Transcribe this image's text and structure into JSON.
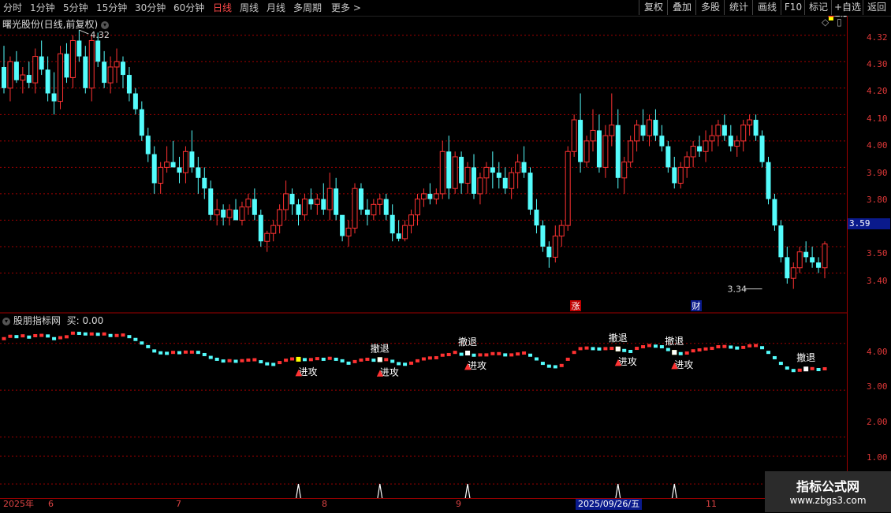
{
  "toolbar": {
    "timeframes": [
      "分时",
      "1分钟",
      "5分钟",
      "15分钟",
      "30分钟",
      "60分钟",
      "日线",
      "周线",
      "月线",
      "多周期",
      "更多 >"
    ],
    "active": "日线",
    "buttons": [
      "复权",
      "叠加",
      "多股",
      "统计",
      "画线",
      "F10",
      "标记",
      "+自选",
      "返回"
    ]
  },
  "main_title": "曙光股份(日线,前复权)",
  "indicator_title": "股朋指标网",
  "indicator_value": "买: 0.00",
  "price_axis": [
    "4.30",
    "4.20",
    "4.10",
    "4.00",
    "3.90",
    "3.80",
    "3.70",
    "3.60",
    "3.50",
    "3.40"
  ],
  "top_tick": "4.32",
  "current_price": "3.59",
  "high_mark": "4.32",
  "low_mark": "3.34",
  "event_markers": [
    "涨",
    "财"
  ],
  "indicator_axis": [
    "4.00",
    "3.00",
    "2.00",
    "1.00"
  ],
  "signals": {
    "retreat": "撤退",
    "attack": "进攻"
  },
  "date_labels": [
    "2025年",
    "6",
    "7",
    "8",
    "9",
    "2025/09/26/五",
    "11"
  ],
  "watermark": {
    "line1": "指标公式网",
    "line2": "www.zbgs3.com"
  },
  "colors": {
    "up": "#ff3232",
    "down": "#54fcfc",
    "signal": "#ffff00",
    "axis": "#a00000"
  },
  "chart_data": {
    "type": "candlestick",
    "candles_ohlc": [
      [
        4.18,
        4.26,
        4.08,
        4.1
      ],
      [
        4.1,
        4.22,
        4.05,
        4.2
      ],
      [
        4.2,
        4.24,
        4.12,
        4.13
      ],
      [
        4.13,
        4.18,
        4.08,
        4.15
      ],
      [
        4.15,
        4.2,
        4.1,
        4.12
      ],
      [
        4.12,
        4.25,
        4.08,
        4.22
      ],
      [
        4.22,
        4.28,
        4.15,
        4.17
      ],
      [
        4.17,
        4.22,
        4.05,
        4.08
      ],
      [
        4.08,
        4.16,
        4.0,
        4.05
      ],
      [
        4.05,
        4.26,
        4.02,
        4.23
      ],
      [
        4.23,
        4.27,
        4.12,
        4.14
      ],
      [
        4.14,
        4.3,
        4.1,
        4.28
      ],
      [
        4.28,
        4.32,
        4.2,
        4.22
      ],
      [
        4.22,
        4.26,
        4.08,
        4.1
      ],
      [
        4.1,
        4.3,
        4.05,
        4.28
      ],
      [
        4.28,
        4.31,
        4.18,
        4.2
      ],
      [
        4.2,
        4.24,
        4.1,
        4.12
      ],
      [
        4.12,
        4.22,
        4.08,
        4.18
      ],
      [
        4.18,
        4.25,
        4.12,
        4.2
      ],
      [
        4.2,
        4.22,
        4.1,
        4.15
      ],
      [
        4.15,
        4.18,
        4.05,
        4.08
      ],
      [
        4.08,
        4.1,
        4.0,
        4.02
      ],
      [
        4.02,
        4.05,
        3.9,
        3.92
      ],
      [
        3.92,
        3.95,
        3.82,
        3.85
      ],
      [
        3.85,
        3.88,
        3.7,
        3.74
      ],
      [
        3.74,
        3.82,
        3.7,
        3.8
      ],
      [
        3.8,
        3.88,
        3.78,
        3.82
      ],
      [
        3.82,
        3.9,
        3.8,
        3.8
      ],
      [
        3.8,
        3.84,
        3.74,
        3.78
      ],
      [
        3.78,
        3.88,
        3.74,
        3.86
      ],
      [
        3.86,
        3.94,
        3.78,
        3.8
      ],
      [
        3.8,
        3.84,
        3.7,
        3.76
      ],
      [
        3.76,
        3.8,
        3.68,
        3.72
      ],
      [
        3.72,
        3.75,
        3.6,
        3.62
      ],
      [
        3.62,
        3.68,
        3.58,
        3.64
      ],
      [
        3.64,
        3.66,
        3.58,
        3.61
      ],
      [
        3.61,
        3.66,
        3.58,
        3.64
      ],
      [
        3.64,
        3.68,
        3.6,
        3.6
      ],
      [
        3.6,
        3.67,
        3.58,
        3.65
      ],
      [
        3.65,
        3.7,
        3.62,
        3.68
      ],
      [
        3.68,
        3.72,
        3.6,
        3.62
      ],
      [
        3.62,
        3.64,
        3.5,
        3.52
      ],
      [
        3.52,
        3.56,
        3.48,
        3.55
      ],
      [
        3.55,
        3.6,
        3.52,
        3.58
      ],
      [
        3.58,
        3.66,
        3.55,
        3.64
      ],
      [
        3.64,
        3.75,
        3.6,
        3.7
      ],
      [
        3.7,
        3.72,
        3.62,
        3.66
      ],
      [
        3.66,
        3.68,
        3.58,
        3.62
      ],
      [
        3.62,
        3.7,
        3.6,
        3.68
      ],
      [
        3.68,
        3.72,
        3.64,
        3.66
      ],
      [
        3.66,
        3.7,
        3.62,
        3.68
      ],
      [
        3.68,
        3.74,
        3.62,
        3.64
      ],
      [
        3.64,
        3.78,
        3.6,
        3.72
      ],
      [
        3.72,
        3.76,
        3.6,
        3.62
      ],
      [
        3.62,
        3.58,
        3.52,
        3.54
      ],
      [
        3.54,
        3.6,
        3.5,
        3.57
      ],
      [
        3.57,
        3.74,
        3.55,
        3.72
      ],
      [
        3.72,
        3.74,
        3.62,
        3.64
      ],
      [
        3.64,
        3.68,
        3.58,
        3.62
      ],
      [
        3.62,
        3.68,
        3.6,
        3.66
      ],
      [
        3.66,
        3.7,
        3.62,
        3.68
      ],
      [
        3.68,
        3.7,
        3.6,
        3.62
      ],
      [
        3.62,
        3.66,
        3.52,
        3.55
      ],
      [
        3.55,
        3.6,
        3.52,
        3.53
      ],
      [
        3.53,
        3.6,
        3.52,
        3.58
      ],
      [
        3.58,
        3.64,
        3.55,
        3.62
      ],
      [
        3.62,
        3.7,
        3.58,
        3.68
      ],
      [
        3.68,
        3.72,
        3.65,
        3.7
      ],
      [
        3.7,
        3.74,
        3.66,
        3.68
      ],
      [
        3.68,
        3.72,
        3.66,
        3.7
      ],
      [
        3.7,
        3.9,
        3.68,
        3.86
      ],
      [
        3.86,
        3.92,
        3.68,
        3.72
      ],
      [
        3.72,
        3.86,
        3.7,
        3.84
      ],
      [
        3.84,
        3.86,
        3.7,
        3.74
      ],
      [
        3.74,
        3.82,
        3.7,
        3.8
      ],
      [
        3.8,
        3.85,
        3.68,
        3.7
      ],
      [
        3.7,
        3.78,
        3.66,
        3.76
      ],
      [
        3.76,
        3.82,
        3.7,
        3.8
      ],
      [
        3.8,
        3.86,
        3.72,
        3.78
      ],
      [
        3.78,
        3.82,
        3.72,
        3.76
      ],
      [
        3.76,
        3.8,
        3.7,
        3.72
      ],
      [
        3.72,
        3.8,
        3.68,
        3.78
      ],
      [
        3.78,
        3.85,
        3.72,
        3.82
      ],
      [
        3.82,
        3.88,
        3.76,
        3.78
      ],
      [
        3.78,
        3.8,
        3.62,
        3.64
      ],
      [
        3.64,
        3.68,
        3.55,
        3.58
      ],
      [
        3.58,
        3.6,
        3.48,
        3.5
      ],
      [
        3.5,
        3.52,
        3.42,
        3.46
      ],
      [
        3.46,
        3.58,
        3.44,
        3.54
      ],
      [
        3.54,
        3.6,
        3.5,
        3.58
      ],
      [
        3.58,
        3.88,
        3.56,
        3.86
      ],
      [
        3.86,
        4.0,
        3.84,
        3.98
      ],
      [
        3.98,
        4.08,
        3.78,
        3.82
      ],
      [
        3.82,
        3.92,
        3.8,
        3.9
      ],
      [
        3.9,
        4.02,
        3.86,
        3.94
      ],
      [
        3.94,
        4.0,
        3.78,
        3.8
      ],
      [
        3.8,
        3.96,
        3.76,
        3.92
      ],
      [
        3.92,
        4.08,
        3.88,
        3.96
      ],
      [
        3.96,
        4.02,
        3.72,
        3.76
      ],
      [
        3.76,
        3.84,
        3.7,
        3.82
      ],
      [
        3.82,
        3.92,
        3.8,
        3.9
      ],
      [
        3.9,
        3.98,
        3.86,
        3.96
      ],
      [
        3.96,
        4.02,
        3.9,
        3.92
      ],
      [
        3.92,
        4.0,
        3.88,
        3.98
      ],
      [
        3.98,
        4.02,
        3.9,
        3.92
      ],
      [
        3.92,
        3.96,
        3.86,
        3.88
      ],
      [
        3.88,
        3.9,
        3.78,
        3.8
      ],
      [
        3.8,
        3.84,
        3.72,
        3.74
      ],
      [
        3.74,
        3.82,
        3.72,
        3.8
      ],
      [
        3.8,
        3.86,
        3.76,
        3.84
      ],
      [
        3.84,
        3.9,
        3.8,
        3.88
      ],
      [
        3.88,
        3.92,
        3.84,
        3.86
      ],
      [
        3.86,
        3.94,
        3.82,
        3.9
      ],
      [
        3.9,
        3.96,
        3.86,
        3.92
      ],
      [
        3.92,
        3.98,
        3.88,
        3.96
      ],
      [
        3.96,
        4.0,
        3.9,
        3.92
      ],
      [
        3.92,
        3.96,
        3.86,
        3.88
      ],
      [
        3.88,
        3.92,
        3.84,
        3.9
      ],
      [
        3.9,
        3.98,
        3.86,
        3.96
      ],
      [
        3.96,
        4.0,
        3.92,
        3.98
      ],
      [
        3.98,
        4.0,
        3.9,
        3.92
      ],
      [
        3.92,
        3.94,
        3.8,
        3.82
      ],
      [
        3.82,
        3.84,
        3.66,
        3.68
      ],
      [
        3.68,
        3.7,
        3.56,
        3.58
      ],
      [
        3.58,
        3.6,
        3.44,
        3.46
      ],
      [
        3.46,
        3.5,
        3.36,
        3.38
      ],
      [
        3.38,
        3.44,
        3.34,
        3.42
      ],
      [
        3.42,
        3.5,
        3.4,
        3.48
      ],
      [
        3.48,
        3.52,
        3.44,
        3.46
      ],
      [
        3.46,
        3.5,
        3.42,
        3.44
      ],
      [
        3.44,
        3.46,
        3.4,
        3.42
      ],
      [
        3.42,
        3.52,
        3.38,
        3.51
      ]
    ],
    "indicator_line": [],
    "signal_spikes": [],
    "ylim": [
      3.3,
      4.35
    ],
    "indicator_ylim": [
      0.7,
      4.6
    ]
  }
}
